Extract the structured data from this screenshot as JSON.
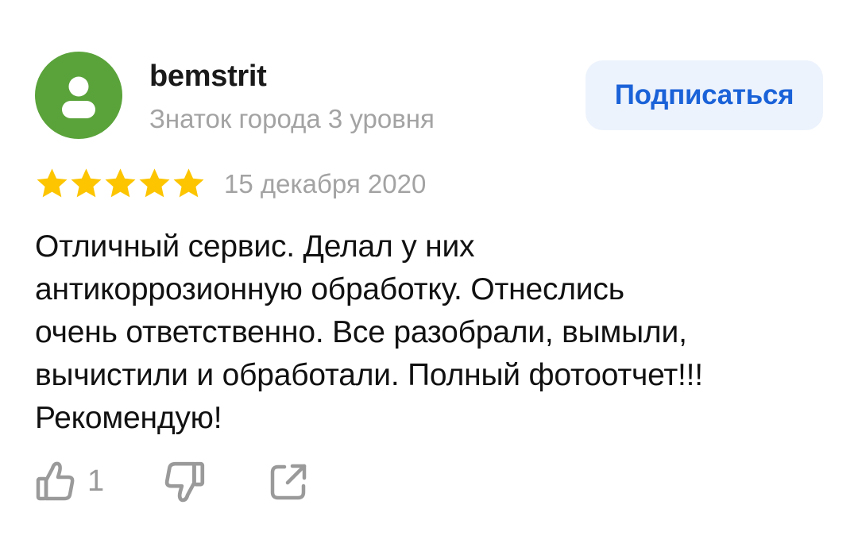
{
  "review": {
    "author": {
      "name": "bemstrit",
      "level": "Знаток города 3 уровня",
      "avatar_icon": "user-silhouette-icon",
      "avatar_color": "#5aa33a"
    },
    "subscribe_label": "Подписаться",
    "rating": {
      "value": 5,
      "max": 5,
      "star_color": "#fcc500"
    },
    "date": "15 декабря 2020",
    "text_lines": [
      "Отличный сервис. Делал у них",
      "антикоррозионную обработку. Отнеслись",
      "очень ответственно. Все разобрали, вымыли,",
      "вычистили и обработали. Полный фотоотчет!!!",
      "Рекомендую!"
    ],
    "actions": {
      "like_icon": "thumbs-up-icon",
      "like_count": "1",
      "dislike_icon": "thumbs-down-icon",
      "share_icon": "share-icon"
    }
  },
  "colors": {
    "accent": "#1a62d8",
    "button_bg": "#edf3fc",
    "secondary_text": "#a3a3a3",
    "icon_gray": "#9a9a9a"
  }
}
